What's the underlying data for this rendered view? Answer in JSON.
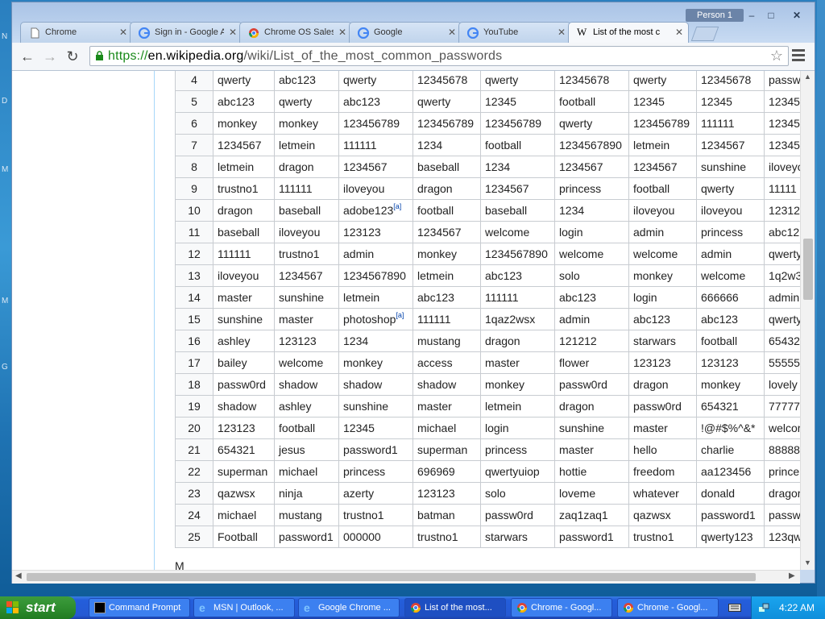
{
  "desktop": {
    "side_letters": [
      "N",
      "D",
      "M",
      "M",
      "G"
    ]
  },
  "window": {
    "profile": "Person 1",
    "tabs": [
      {
        "label": "Chrome",
        "icon": "page-icon"
      },
      {
        "label": "Sign in - Google A",
        "icon": "google-icon"
      },
      {
        "label": "Chrome OS Sales",
        "icon": "chrome-icon"
      },
      {
        "label": "Google",
        "icon": "google-icon"
      },
      {
        "label": "YouTube",
        "icon": "google-icon"
      },
      {
        "label": "List of the most c",
        "icon": "wikipedia-icon"
      }
    ],
    "url": {
      "scheme": "https://",
      "host": "en.wikipedia.org",
      "path": "/wiki/List_of_the_most_common_passwords"
    }
  },
  "table": {
    "rows": [
      [
        "4",
        "qwerty",
        "abc123",
        "qwerty",
        "12345678",
        "qwerty",
        "12345678",
        "qwerty",
        "12345678",
        "passw"
      ],
      [
        "5",
        "abc123",
        "qwerty",
        "abc123",
        "qwerty",
        "12345",
        "football",
        "12345",
        "12345",
        "12345"
      ],
      [
        "6",
        "monkey",
        "monkey",
        "123456789",
        "123456789",
        "123456789",
        "qwerty",
        "123456789",
        "111111",
        "12345"
      ],
      [
        "7",
        "1234567",
        "letmein",
        "111111",
        "1234",
        "football",
        "1234567890",
        "letmein",
        "1234567",
        "12345"
      ],
      [
        "8",
        "letmein",
        "dragon",
        "1234567",
        "baseball",
        "1234",
        "1234567",
        "1234567",
        "sunshine",
        "iloveyo"
      ],
      [
        "9",
        "trustno1",
        "111111",
        "iloveyou",
        "dragon",
        "1234567",
        "princess",
        "football",
        "qwerty",
        "11111"
      ],
      [
        "10",
        "dragon",
        "baseball",
        "adobe123",
        "football",
        "baseball",
        "1234",
        "iloveyou",
        "iloveyou",
        "12312"
      ],
      [
        "11",
        "baseball",
        "iloveyou",
        "123123",
        "1234567",
        "welcome",
        "login",
        "admin",
        "princess",
        "abc12"
      ],
      [
        "12",
        "111111",
        "trustno1",
        "admin",
        "monkey",
        "1234567890",
        "welcome",
        "welcome",
        "admin",
        "qwerty"
      ],
      [
        "13",
        "iloveyou",
        "1234567",
        "1234567890",
        "letmein",
        "abc123",
        "solo",
        "monkey",
        "welcome",
        "1q2w3"
      ],
      [
        "14",
        "master",
        "sunshine",
        "letmein",
        "abc123",
        "111111",
        "abc123",
        "login",
        "666666",
        "admin"
      ],
      [
        "15",
        "sunshine",
        "master",
        "photoshop",
        "111111",
        "1qaz2wsx",
        "admin",
        "abc123",
        "abc123",
        "qwerty"
      ],
      [
        "16",
        "ashley",
        "123123",
        "1234",
        "mustang",
        "dragon",
        "121212",
        "starwars",
        "football",
        "65432"
      ],
      [
        "17",
        "bailey",
        "welcome",
        "monkey",
        "access",
        "master",
        "flower",
        "123123",
        "123123",
        "55555"
      ],
      [
        "18",
        "passw0rd",
        "shadow",
        "shadow",
        "shadow",
        "monkey",
        "passw0rd",
        "dragon",
        "monkey",
        "lovely"
      ],
      [
        "19",
        "shadow",
        "ashley",
        "sunshine",
        "master",
        "letmein",
        "dragon",
        "passw0rd",
        "654321",
        "77777"
      ],
      [
        "20",
        "123123",
        "football",
        "12345",
        "michael",
        "login",
        "sunshine",
        "master",
        "!@#$%^&*",
        "welcor"
      ],
      [
        "21",
        "654321",
        "jesus",
        "password1",
        "superman",
        "princess",
        "master",
        "hello",
        "charlie",
        "88888"
      ],
      [
        "22",
        "superman",
        "michael",
        "princess",
        "696969",
        "qwertyuiop",
        "hottie",
        "freedom",
        "aa123456",
        "prince"
      ],
      [
        "23",
        "qazwsx",
        "ninja",
        "azerty",
        "123123",
        "solo",
        "loveme",
        "whatever",
        "donald",
        "dragor"
      ],
      [
        "24",
        "michael",
        "mustang",
        "trustno1",
        "batman",
        "passw0rd",
        "zaq1zaq1",
        "qazwsx",
        "password1",
        "passw"
      ],
      [
        "25",
        "Football",
        "password1",
        "000000",
        "trustno1",
        "starwars",
        "password1",
        "trustno1",
        "qwerty123",
        "123qw"
      ]
    ],
    "notes": {
      "10": "[a]",
      "15": "[a]"
    },
    "below_text": "M"
  },
  "taskbar": {
    "start_label": "start",
    "items": [
      {
        "label": "Command Prompt",
        "icon": "cmd-icon"
      },
      {
        "label": "MSN | Outlook, ...",
        "icon": "ie-icon"
      },
      {
        "label": "Google Chrome ...",
        "icon": "ie-icon"
      },
      {
        "label": "List of the most...",
        "icon": "chrome-icon"
      },
      {
        "label": "Chrome - Googl...",
        "icon": "chrome-icon"
      },
      {
        "label": "Chrome - Googl...",
        "icon": "chrome-icon"
      }
    ],
    "clock": "4:22 AM"
  },
  "colors": {
    "link": "#0645ad",
    "https": "#1a8a1a",
    "taskbar": "#245edb",
    "start": "#2c8a2c"
  }
}
